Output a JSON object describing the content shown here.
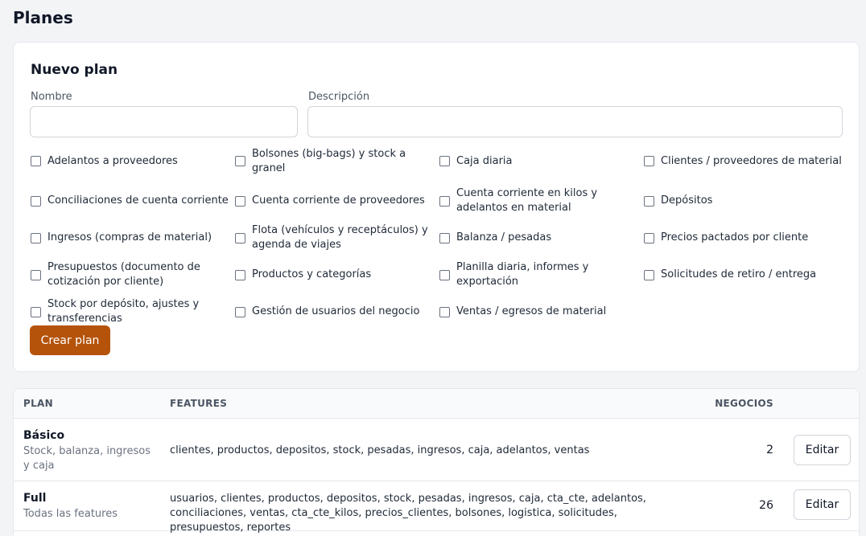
{
  "page": {
    "title": "Planes"
  },
  "form": {
    "title": "Nuevo plan",
    "name_label": "Nombre",
    "name_value": "",
    "description_label": "Descripción",
    "description_value": "",
    "features": [
      "Adelantos a proveedores",
      "Bolsones (big-bags) y stock a granel",
      "Caja diaria",
      "Clientes / proveedores de material",
      "Conciliaciones de cuenta corriente",
      "Cuenta corriente de proveedores",
      "Cuenta corriente en kilos y adelantos en material",
      "Depósitos",
      "Ingresos (compras de material)",
      "Flota (vehículos y receptáculos) y agenda de viajes",
      "Balanza / pesadas",
      "Precios pactados por cliente",
      "Presupuestos (documento de cotización por cliente)",
      "Productos y categorías",
      "Planilla diaria, informes y exportación",
      "Solicitudes de retiro / entrega",
      "Stock por depósito, ajustes y transferencias",
      "Gestión de usuarios del negocio",
      "Ventas / egresos de material"
    ],
    "create_label": "Crear plan"
  },
  "table": {
    "headers": {
      "plan": "PLAN",
      "features": "FEATURES",
      "count": "NEGOCIOS"
    },
    "rows": [
      {
        "name": "Básico",
        "description": "Stock, balanza, ingresos y caja",
        "features": "clientes, productos, depositos, stock, pesadas, ingresos, caja, adelantos, ventas",
        "count": "2",
        "edit_label": "Editar"
      },
      {
        "name": "Full",
        "description": "Todas las features",
        "features": "usuarios, clientes, productos, depositos, stock, pesadas, ingresos, caja, cta_cte, adelantos, conciliaciones, ventas, cta_cte_kilos, precios_clientes, bolsones, logistica, solicitudes, presupuestos, reportes",
        "count": "26",
        "edit_label": "Editar"
      }
    ]
  },
  "colors": {
    "primary": "#b45309",
    "background": "#f3f4f6",
    "border": "#e5e7eb"
  }
}
